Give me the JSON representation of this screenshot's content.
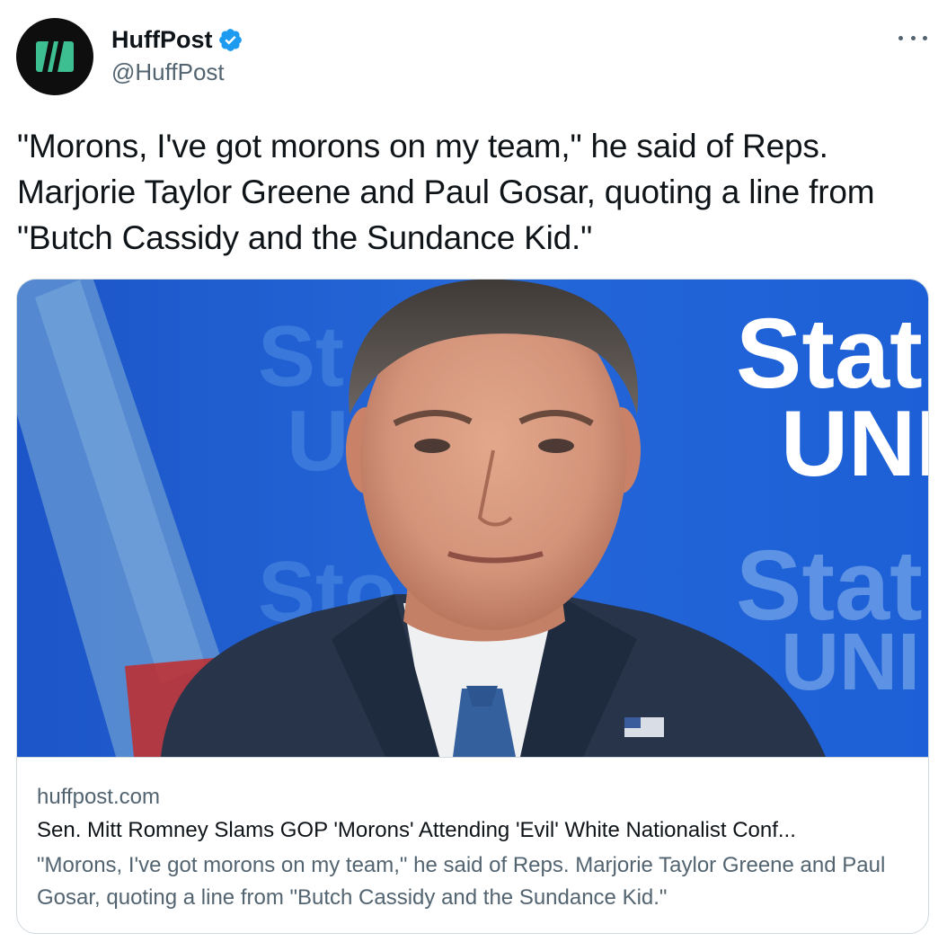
{
  "author": {
    "display_name": "HuffPost",
    "handle": "@HuffPost",
    "verified": true,
    "avatar_colors": {
      "background": "#0e0e0e",
      "mark": "#3ebf92"
    }
  },
  "menu": {
    "icon": "more-horizontal-icon"
  },
  "tweet": {
    "text": "\"Morons, I've got morons on my team,\" he said of Reps. Marjorie Taylor Greene and Paul Gosar, quoting a line from \"Butch Cassidy and the Sundance Kid.\""
  },
  "link_card": {
    "image": {
      "description_icon": "news-photo",
      "background_text": {
        "left_top": "St",
        "left_mid": "U",
        "left_bottom": "Sto",
        "right_top": "Stat",
        "right_mid": "UNI",
        "right_bottom": "Stat",
        "right_bottom2": "UNI"
      }
    },
    "domain": "huffpost.com",
    "title": "Sen. Mitt Romney Slams GOP 'Morons' Attending 'Evil' White Nationalist Conf...",
    "description": "\"Morons, I've got morons on my team,\" he said of Reps. Marjorie Taylor Greene and Paul Gosar, quoting a line from \"Butch Cassidy and the Sundance Kid.\""
  },
  "colors": {
    "text_primary": "#0f1419",
    "text_secondary": "#536471",
    "border": "#cfd9de",
    "verified_blue": "#1d9bf0",
    "studio_blue": "#1a63d6"
  }
}
